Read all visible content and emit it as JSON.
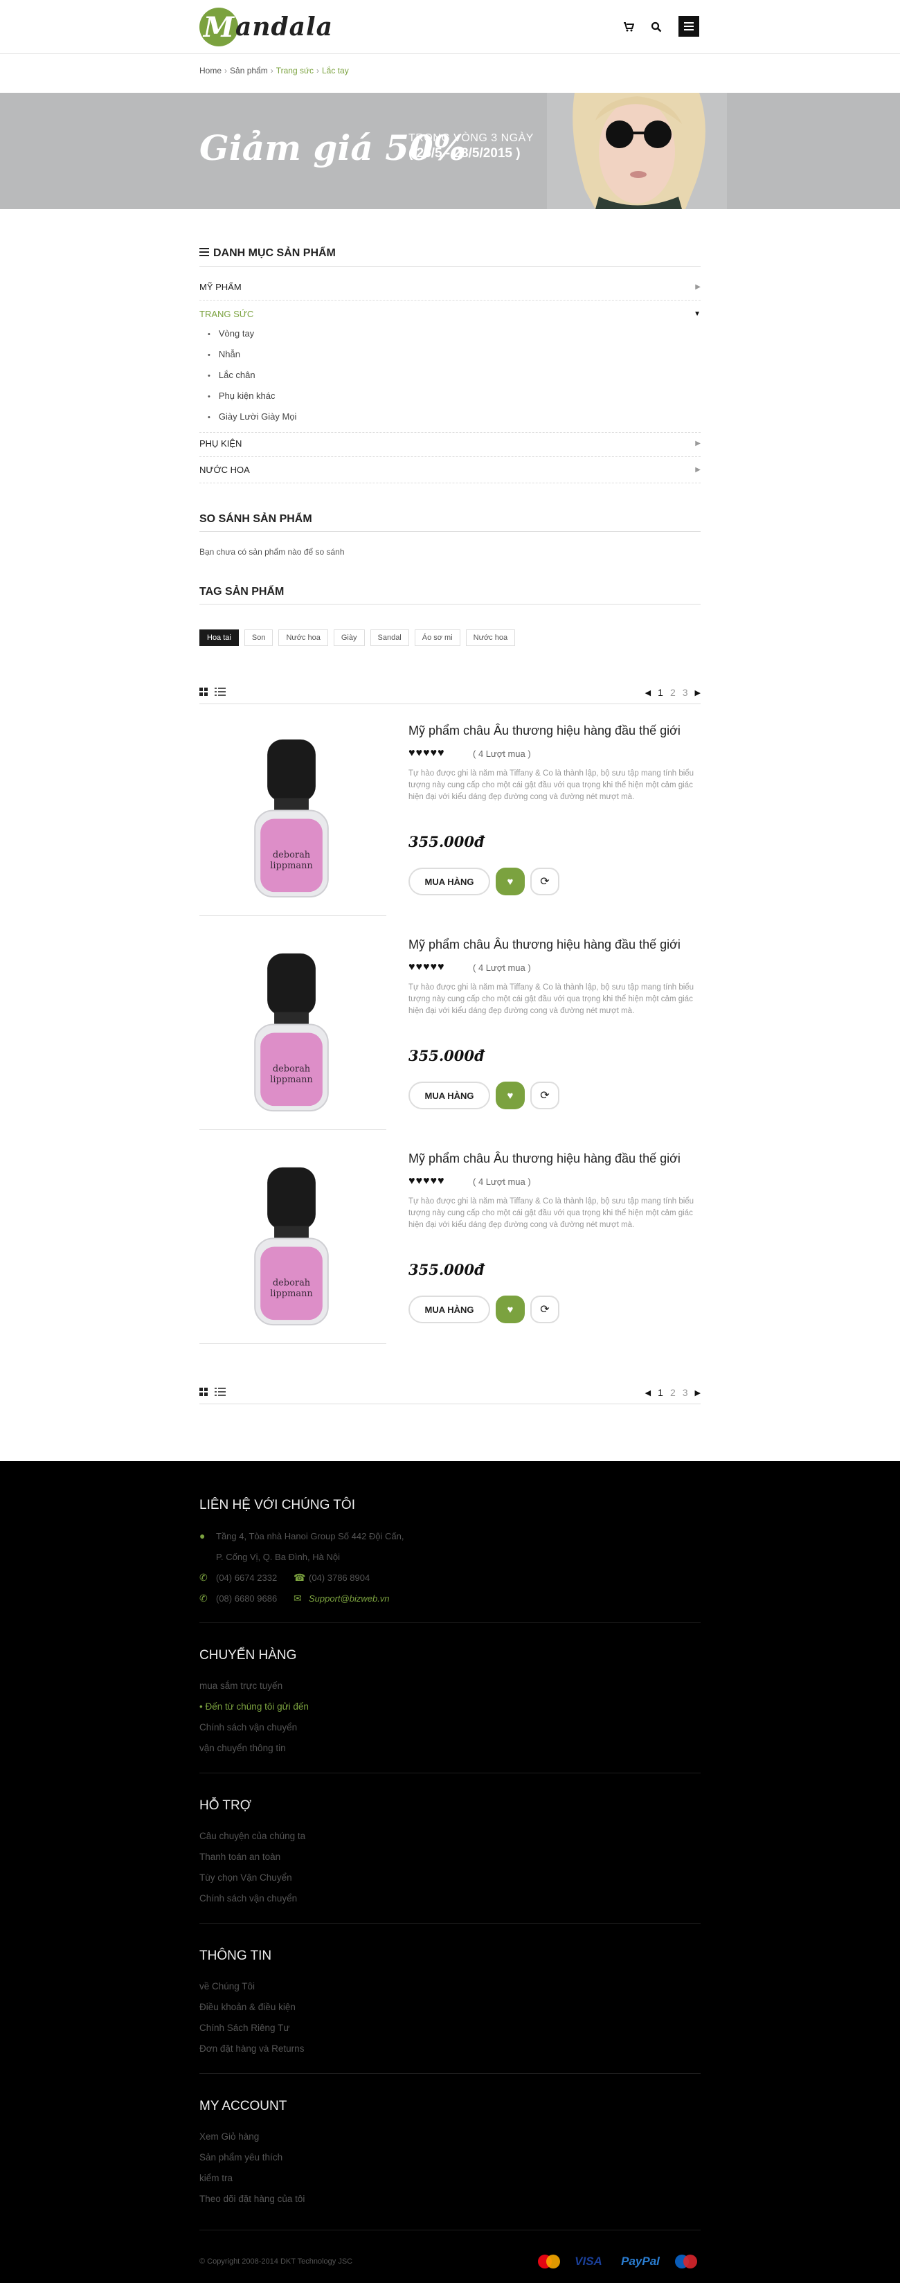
{
  "header": {
    "logo_letter": "M",
    "logo_rest": "andala",
    "cart_icon": "cart-icon",
    "search_icon": "search-icon",
    "menu_icon": "hamburger-icon"
  },
  "breadcrumb": {
    "home": "Home",
    "products": "Sản phẩm",
    "jewelry": "Trang sức",
    "current": "Lắc tay"
  },
  "banner": {
    "title": "Giảm giá 50%",
    "line1": "TRONG VÒNG 3 NGÀY",
    "line2": "( 25/5 - 28/5/2015 )"
  },
  "categories": {
    "title": "DANH MỤC SẢN PHẨM",
    "items": [
      {
        "label": "MỸ PHẨM"
      },
      {
        "label": "TRANG SỨC"
      },
      {
        "label": "PHỤ KIỆN"
      },
      {
        "label": "NƯỚC HOA"
      }
    ],
    "sub_items": [
      "Vòng tay",
      "Nhẫn",
      "Lắc chân",
      "Phụ kiện khác",
      "Giày Lười Giày Mọi"
    ]
  },
  "compare": {
    "title": "SO SÁNH SẢN PHẨM",
    "text": "Bạn chưa có sản phẩm nào để so sánh"
  },
  "tags": {
    "title": "TAG SẢN PHẨM",
    "items": [
      "Hoa tai",
      "Son",
      "Nước hoa",
      "Giày",
      "Sandal",
      "Áo sơ mi",
      "Nước hoa"
    ]
  },
  "pager": {
    "pages": [
      "1",
      "2",
      "3"
    ],
    "current": "1"
  },
  "products": [
    {
      "name": "Mỹ phẩm châu Âu thương hiệu hàng  đầu thế giới",
      "rating": 5,
      "count": "( 4 Lượt mua )",
      "desc": "Tự hào được ghi là năm mà Tiffany & Co là thành lập, bộ sưu tập mang tính biểu tượng này cung cấp cho một cái gật đầu với qua trọng khi thể hiện một cảm giác hiện đại với kiểu dáng đẹp đường cong và đường nét mượt mà.",
      "price": "355.000đ",
      "buy": "MUA HÀNG",
      "brand_label": "deborah lippmann"
    },
    {
      "name": "Mỹ phẩm châu Âu thương hiệu hàng  đầu thế giới",
      "rating": 5,
      "count": "( 4 Lượt mua )",
      "desc": "Tự hào được ghi là năm mà Tiffany & Co là thành lập, bộ sưu tập mang tính biểu tượng này cung cấp cho một cái gật đầu với qua trọng khi thể hiện một cảm giác hiện đại với kiểu dáng đẹp đường cong và đường nét mượt mà.",
      "price": "355.000đ",
      "buy": "MUA HÀNG",
      "brand_label": "deborah lippmann"
    },
    {
      "name": "Mỹ phẩm châu Âu thương hiệu hàng  đầu thế giới",
      "rating": 5,
      "count": "( 4 Lượt mua )",
      "desc": "Tự hào được ghi là năm mà Tiffany & Co là thành lập, bộ sưu tập mang tính biểu tượng này cung cấp cho một cái gật đầu với qua trọng khi thể hiện một cảm giác hiện đại với kiểu dáng đẹp đường cong và đường nét mượt mà.",
      "price": "355.000đ",
      "buy": "MUA HÀNG",
      "brand_label": "deborah lippmann"
    }
  ],
  "footer": {
    "contact": {
      "title": "LIÊN HỆ VỚI CHÚNG TÔI",
      "address1": "Tầng 4, Tòa nhà Hanoi Group  Số 442 Đội Cấn,",
      "address2": "P. Cống Vị, Q. Ba Đình, Hà Nội",
      "phone1": "(04) 6674 2332",
      "fax": "(04) 3786 8904",
      "phone2": "(08) 6680 9686",
      "email": "Support@bizweb.vn"
    },
    "shipping": {
      "title": "CHUYỂN HÀNG",
      "links": [
        "mua sắm trực tuyến",
        "Đến từ chúng tôi gửi đến",
        "Chính sách vận chuyển",
        "vận chuyển thông tin"
      ]
    },
    "support": {
      "title": "HỖ TRỢ",
      "links": [
        "Câu chuyện của chúng ta",
        "Thanh toán an toàn",
        "Tùy chọn Vận Chuyển",
        "Chính sách vận chuyển"
      ]
    },
    "info": {
      "title": "THÔNG TIN",
      "links": [
        "về Chúng Tôi",
        "Điều khoản & điều kiện",
        "Chính Sách Riêng Tư",
        "Đơn đặt hàng và Returns"
      ]
    },
    "account": {
      "title": "MY ACCOUNT",
      "links": [
        "Xem Giỏ hàng",
        "Sản phẩm yêu thích",
        "kiểm tra",
        "Theo dõi đặt hàng của tôi"
      ]
    },
    "copyright": "© Copyright 2008-2014 DKT Technology JSC",
    "payments": {
      "visa": "VISA",
      "paypal": "PayPal"
    }
  },
  "colors": {
    "accent": "#7ba23f",
    "footer_bg": "#000000",
    "banner_bg": "#b9babb"
  }
}
